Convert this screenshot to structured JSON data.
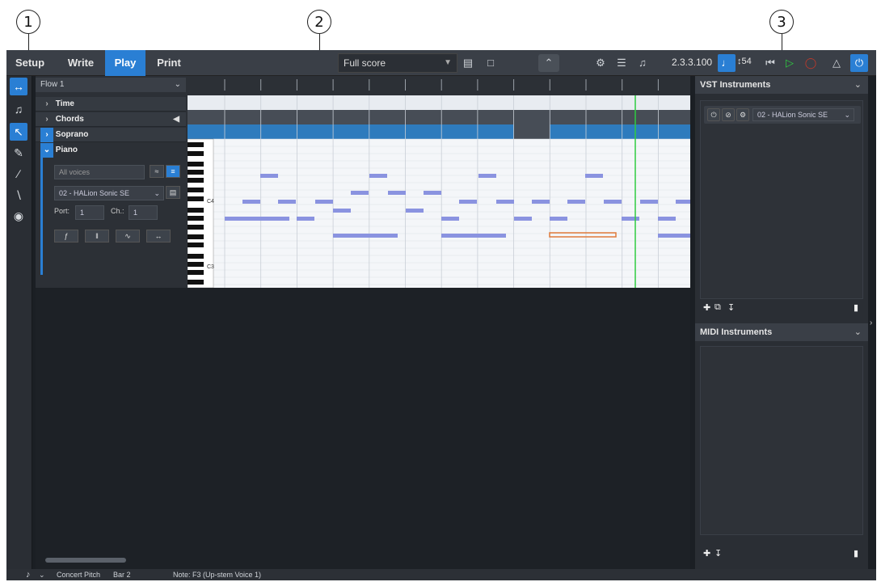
{
  "callouts": [
    "1",
    "2",
    "3"
  ],
  "toolbar": {
    "modes": [
      "Setup",
      "Write",
      "Play",
      "Print"
    ],
    "active_mode": "Play",
    "layout": "Full score",
    "time_display": "2.3.3.100",
    "tempo": "54"
  },
  "track_panel": {
    "flow": "Flow 1",
    "tracks": [
      "Time",
      "Chords",
      "Soprano",
      "Piano"
    ],
    "voices_label": "All voices",
    "instrument": "02 - HALion Sonic SE",
    "port_label": "Port:",
    "port_value": "1",
    "channel_label": "Ch.:",
    "channel_value": "1"
  },
  "piano_roll": {
    "key_labels": [
      "C4",
      "C3"
    ]
  },
  "right_panel": {
    "vst_title": "VST Instruments",
    "vst_instrument": "02 - HALion Sonic SE",
    "midi_title": "MIDI Instruments"
  },
  "statusbar": {
    "concert_pitch": "Concert Pitch",
    "bar": "Bar 2",
    "note": "Note: F3 (Up-stem Voice 1)"
  },
  "colors": {
    "accent": "#2a7fd4",
    "note": "#8a93e0",
    "selected_note": "#e07a3a",
    "playhead": "#2ecc40"
  }
}
